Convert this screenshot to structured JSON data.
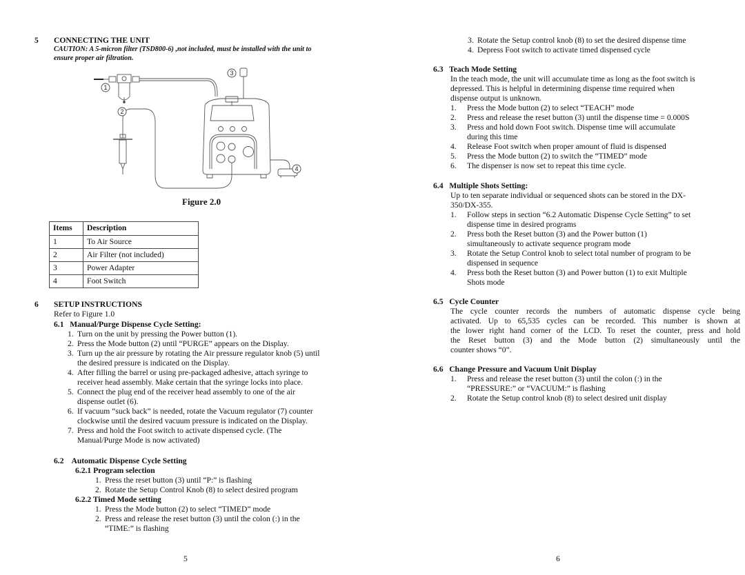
{
  "left_page": {
    "section5": {
      "number": "5",
      "title": "CONNECTING THE UNIT",
      "caution_line1": "CAUTION: A 5-micron filter (TSD800-6) ,not included,  must be installed with the unit to",
      "caution_line2": "ensure proper air filtration."
    },
    "figure": {
      "callouts": [
        "1",
        "2",
        "3",
        "4"
      ],
      "caption": "Figure 2.0"
    },
    "items_table": {
      "headers": [
        "Items",
        "Description"
      ],
      "rows": [
        {
          "item": "1",
          "description": "To Air Source"
        },
        {
          "item": "2",
          "description": "Air Filter (not included)"
        },
        {
          "item": "3",
          "description": "Power Adapter"
        },
        {
          "item": "4",
          "description": "Foot Switch"
        }
      ]
    },
    "section6": {
      "number": "6",
      "title": "SETUP INSTRUCTIONS",
      "refer": "Refer to Figure 1.0",
      "s61_title": "6.1   Manual/Purge Dispense Cycle Setting:",
      "s61_steps": [
        {
          "n": "1.",
          "lines": [
            "Turn on the unit by pressing the Power button (1)."
          ]
        },
        {
          "n": "2.",
          "lines": [
            "Press the Mode button (2) until “PURGE” appears on the Display."
          ]
        },
        {
          "n": "3.",
          "lines": [
            "Turn up the air pressure by rotating the Air pressure regulator knob (5) until",
            "the desired pressure is indicated on the Display."
          ]
        },
        {
          "n": "4.",
          "lines": [
            "After filling the barrel or using pre-packaged adhesive, attach syringe to",
            "receiver head assembly.  Make certain that the syringe locks into place."
          ]
        },
        {
          "n": "5.",
          "lines": [
            "Connect the plug end of the receiver head assembly to one of the air",
            "dispense outlet (6)."
          ]
        },
        {
          "n": "6.",
          "lines": [
            "If vacuum “suck back” is needed, rotate the Vacuum regulator (7) counter",
            "clockwise until the desired vacuum pressure is indicated on the Display."
          ]
        },
        {
          "n": "7.",
          "lines": [
            "Press and hold the Foot switch to activate dispensed cycle. (The",
            "Manual/Purge Mode is now activated)"
          ]
        }
      ],
      "s62_title": "6.2    Automatic Dispense Cycle Setting",
      "s621_title": "6.2.1 Program selection",
      "s621_steps": [
        {
          "n": "1.",
          "lines": [
            "Press the reset button (3) until “P:” is flashing"
          ]
        },
        {
          "n": "2.",
          "lines": [
            "Rotate the Setup Control Knob (8) to select desired program"
          ]
        }
      ],
      "s622_title": "6.2.2 Timed Mode setting",
      "s622_steps": [
        {
          "n": "1.",
          "lines": [
            "Press the Mode button (2) to select “TIMED” mode"
          ]
        },
        {
          "n": "2.",
          "lines": [
            "Press and release the reset button (3) until the colon (:) in the",
            "“TIME:” is flashing"
          ]
        }
      ]
    },
    "page_number": "5"
  },
  "right_page": {
    "s622_cont_steps": [
      {
        "n": "3.",
        "lines": [
          "Rotate the Setup control knob (8) to set the desired dispense time"
        ]
      },
      {
        "n": "4.",
        "lines": [
          "Depress Foot switch to activate timed dispensed cycle"
        ]
      }
    ],
    "s63": {
      "title": "6.3   Teach Mode Setting",
      "intro": [
        "In the teach mode, the unit will accumulate time as long as the foot switch is",
        "depressed.  This is helpful in determining dispense time required when",
        "dispense output is unknown."
      ],
      "steps": [
        {
          "n": "1.",
          "lines": [
            "Press the Mode button (2) to select “TEACH” mode"
          ]
        },
        {
          "n": "2.",
          "lines": [
            "Press and release the reset button (3) until the dispense time = 0.000S"
          ]
        },
        {
          "n": "3.",
          "lines": [
            "Press and hold down Foot switch.  Dispense time will accumulate",
            "during this time"
          ]
        },
        {
          "n": "4.",
          "lines": [
            "Release Foot switch when proper amount of fluid is dispensed"
          ]
        },
        {
          "n": "5.",
          "lines": [
            "Press the Mode button (2) to switch the “TIMED” mode"
          ]
        },
        {
          "n": "6.",
          "lines": [
            "The dispenser is now set to repeat this time cycle."
          ]
        }
      ]
    },
    "s64": {
      "title": "6.4   Multiple Shots Setting:",
      "intro": [
        "Up to ten separate individual or sequenced shots can be stored in the DX-",
        "350/DX-355."
      ],
      "steps": [
        {
          "n": "1.",
          "lines": [
            "Follow steps in section “6.2 Automatic Dispense Cycle Setting” to set",
            "dispense time in desired programs"
          ]
        },
        {
          "n": "2.",
          "lines": [
            "Press both the Reset button (3) and the Power button (1)",
            "simultaneously to activate sequence program mode"
          ]
        },
        {
          "n": "3.",
          "lines": [
            "Rotate the Setup Control knob to select total number of program to be",
            "dispensed in sequence"
          ]
        },
        {
          "n": "4.",
          "lines": [
            "Press both the Reset button (3) and Power button (1) to exit Multiple",
            "Shots mode"
          ]
        }
      ]
    },
    "s65": {
      "title": "6.5   Cycle Counter",
      "body": [
        "The cycle counter records the numbers of automatic dispense cycle being",
        "activated.  Up to 65,535 cycles can be recorded.  This number is shown at",
        "the lower right hand corner of the LCD.  To reset the counter, press and hold",
        "the Reset button (3) and the Mode button (2) simultaneously until the",
        "counter shows “0”."
      ]
    },
    "s66": {
      "title": "6.6   Change Pressure and Vacuum Unit Display",
      "steps": [
        {
          "n": "1.",
          "lines": [
            "Press and release the reset button (3) until the colon (:) in the",
            "“PRESSURE:” or “VACUUM:” is flashing"
          ]
        },
        {
          "n": "2.",
          "lines": [
            "Rotate the Setup control knob (8) to select desired unit display"
          ]
        }
      ]
    },
    "page_number": "6"
  }
}
